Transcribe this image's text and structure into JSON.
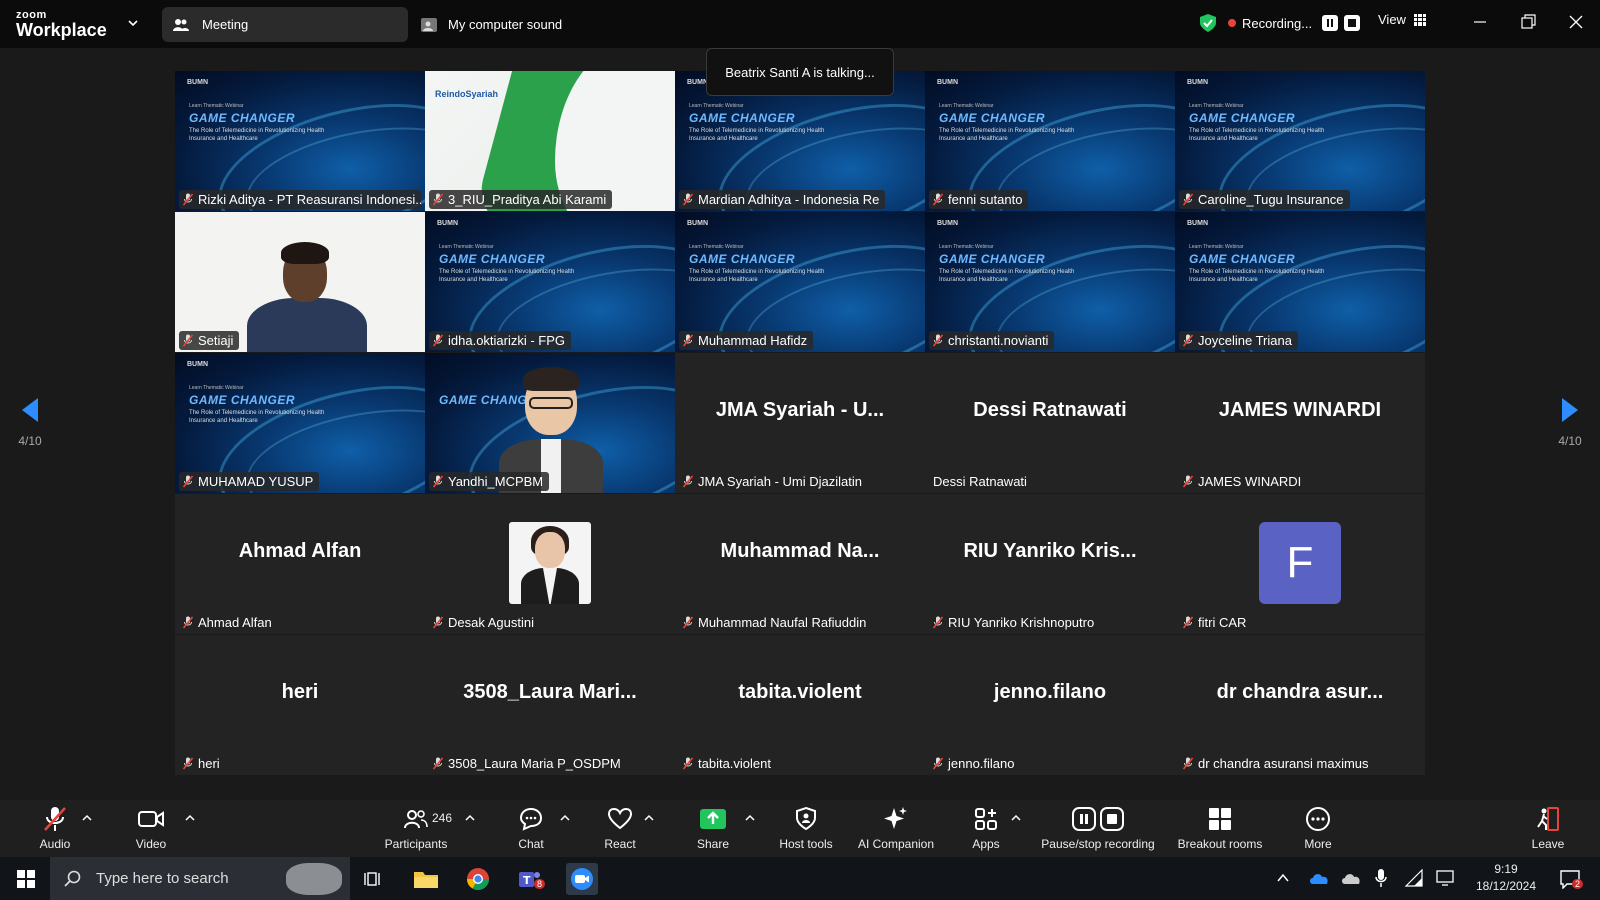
{
  "app": {
    "brand_small": "zoom",
    "brand_big": "Workplace"
  },
  "tabs": {
    "meeting": "Meeting",
    "sound": "My computer sound"
  },
  "recording": {
    "label": "Recording..."
  },
  "view": {
    "label": "View"
  },
  "talking": "Beatrix Santi A is talking...",
  "webinar_slide": {
    "brand": "BUMN",
    "kicker": "Learn Thematic Webinar",
    "title": "GAME CHANGER",
    "subtitle": "The Role of Telemedicine in Revolutionizing Health Insurance and Healthcare"
  },
  "reindo_logo": "ReindoSyariah",
  "page_indicator": "4/10",
  "participants": [
    {
      "tag": "Rizki Aditya - PT Reasuransi Indonesi...",
      "type": "webinar",
      "muted": true
    },
    {
      "tag": "3_RIU_Praditya Abi Karami",
      "type": "reindo",
      "muted": true
    },
    {
      "tag": "Mardian Adhitya - Indonesia Re",
      "type": "webinar",
      "muted": true
    },
    {
      "tag": "fenni sutanto",
      "type": "webinar",
      "muted": true
    },
    {
      "tag": "Caroline_Tugu Insurance",
      "type": "webinar",
      "muted": true
    },
    {
      "tag": "Setiaji",
      "type": "camera",
      "muted": true
    },
    {
      "tag": "idha.oktiarizki - FPG",
      "type": "webinar",
      "muted": true
    },
    {
      "tag": "Muhammad Hafidz",
      "type": "webinar",
      "muted": true
    },
    {
      "tag": "christanti.novianti",
      "type": "webinar",
      "muted": true
    },
    {
      "tag": "Joyceline Triana",
      "type": "webinar",
      "muted": true
    },
    {
      "tag": "MUHAMAD YUSUP",
      "type": "webinar",
      "muted": true
    },
    {
      "tag": "Yandhi_MCPBM",
      "type": "avatar3d",
      "muted": true
    },
    {
      "tag": "JMA Syariah - Umi Djazilatin",
      "big": "JMA Syariah - U...",
      "type": "name",
      "muted": true
    },
    {
      "tag": "Dessi Ratnawati",
      "big": "Dessi Ratnawati",
      "type": "name",
      "muted": false
    },
    {
      "tag": "JAMES WINARDI",
      "big": "JAMES WINARDI",
      "type": "name",
      "muted": true
    },
    {
      "tag": "Ahmad Alfan",
      "big": "Ahmad Alfan",
      "type": "name",
      "muted": true
    },
    {
      "tag": "Desak Agustini",
      "type": "photo",
      "muted": true
    },
    {
      "tag": "Muhammad Naufal Rafiuddin",
      "big": "Muhammad Na...",
      "type": "name",
      "muted": true
    },
    {
      "tag": "RIU Yanriko Krishnoputro",
      "big": "RIU Yanriko Kris...",
      "type": "name",
      "muted": true
    },
    {
      "tag": "fitri CAR",
      "initial": "F",
      "type": "initial",
      "muted": true
    },
    {
      "tag": "heri",
      "big": "heri",
      "type": "name",
      "muted": true
    },
    {
      "tag": "3508_Laura Maria P_OSDPM",
      "big": "3508_Laura Mari...",
      "type": "name",
      "muted": true
    },
    {
      "tag": "tabita.violent",
      "big": "tabita.violent",
      "type": "name",
      "muted": true
    },
    {
      "tag": "jenno.filano",
      "big": "jenno.filano",
      "type": "name",
      "muted": true
    },
    {
      "tag": "dr chandra asuransi maximus",
      "big": "dr chandra asur...",
      "type": "name",
      "muted": true
    }
  ],
  "toolbar": {
    "audio": "Audio",
    "video": "Video",
    "participants": "Participants",
    "participants_count": "246",
    "chat": "Chat",
    "react": "React",
    "share": "Share",
    "host_tools": "Host tools",
    "ai_companion": "AI Companion",
    "apps": "Apps",
    "pause_stop": "Pause/stop recording",
    "breakout": "Breakout rooms",
    "more": "More",
    "leave": "Leave"
  },
  "taskbar": {
    "search_placeholder": "Type here to search",
    "time": "9:19",
    "date": "18/12/2024",
    "teams_badge": "8",
    "notif_badge": "2"
  },
  "colors": {
    "accent_blue": "#0e72ed",
    "share_green": "#21c45d",
    "mute_red": "#e8443a",
    "leave_red": "#e8443a"
  }
}
